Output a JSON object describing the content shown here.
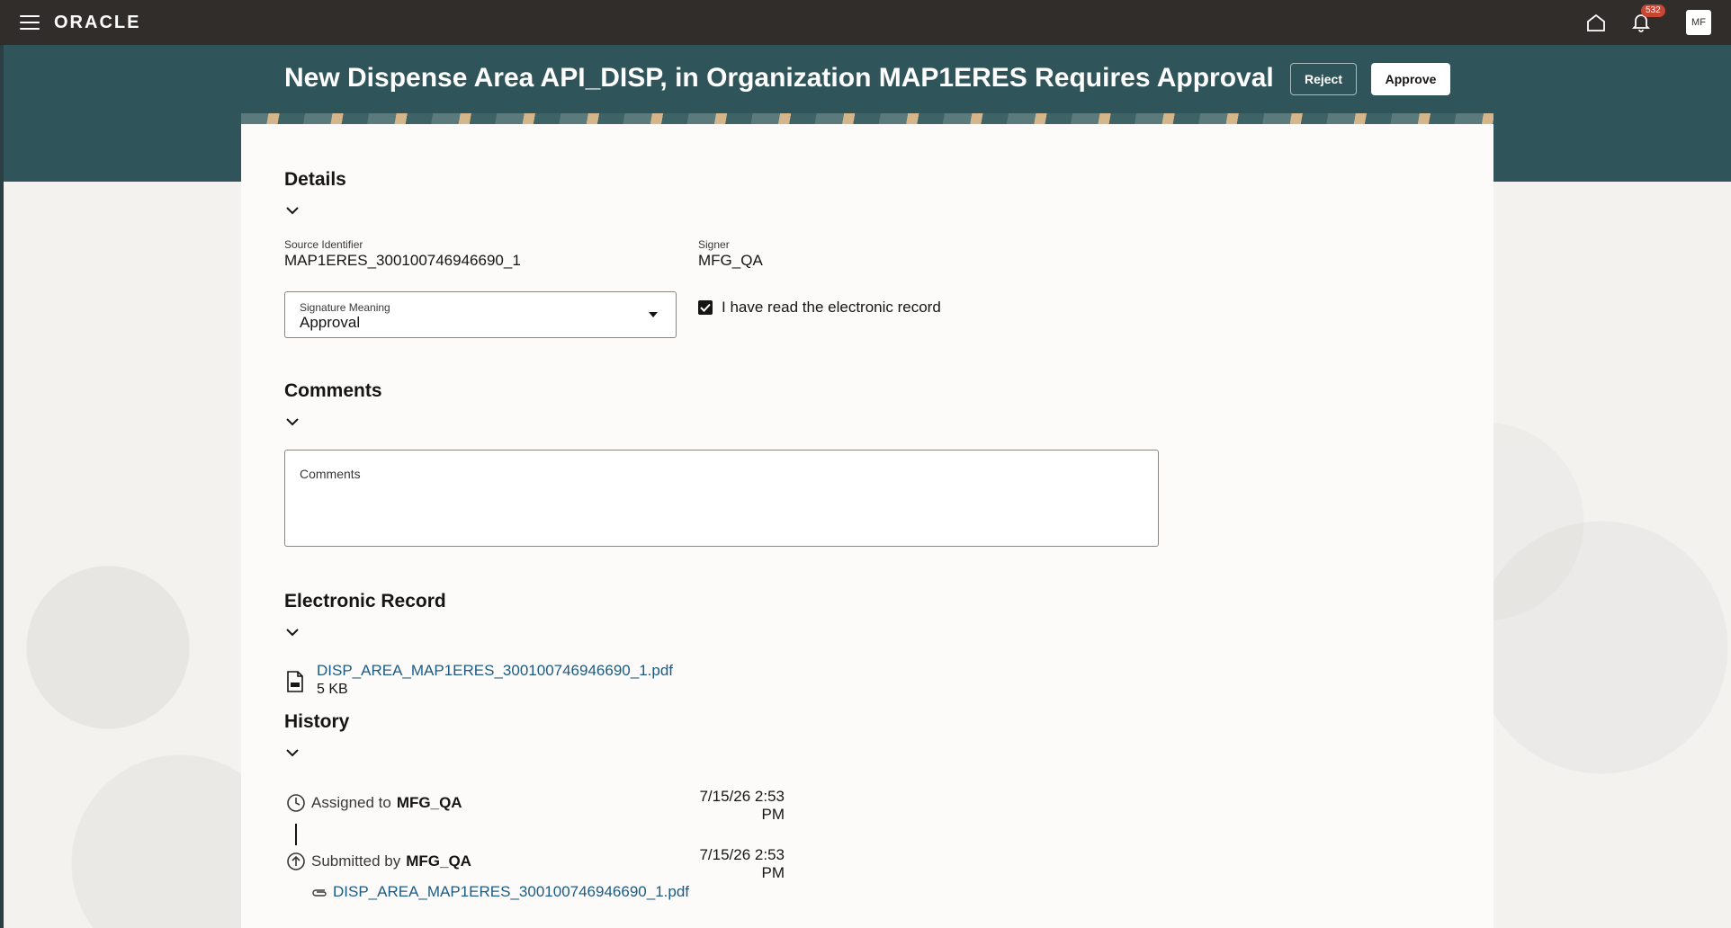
{
  "topbar": {
    "logo": "ORACLE",
    "notification_count": "532",
    "avatar_initials": "MF"
  },
  "header": {
    "title": "New Dispense Area API_DISP, in Organization MAP1ERES Requires Approval",
    "reject_label": "Reject",
    "approve_label": "Approve"
  },
  "details": {
    "title": "Details",
    "source_identifier_label": "Source Identifier",
    "source_identifier_value": "MAP1ERES_300100746946690_1",
    "signer_label": "Signer",
    "signer_value": "MFG_QA",
    "signature_meaning_label": "Signature Meaning",
    "signature_meaning_value": "Approval",
    "read_record_label": "I have read the electronic record",
    "read_record_checked": true
  },
  "comments": {
    "title": "Comments",
    "field_label": "Comments"
  },
  "electronic_record": {
    "title": "Electronic Record",
    "file_name": "DISP_AREA_MAP1ERES_300100746946690_1.pdf",
    "file_size": "5 KB"
  },
  "history": {
    "title": "History",
    "items": [
      {
        "prefix": "Assigned to",
        "user": "MFG_QA",
        "date": "7/15/26 2:53",
        "time": "PM"
      },
      {
        "prefix": "Submitted by",
        "user": "MFG_QA",
        "date": "7/15/26 2:53",
        "time": "PM",
        "attachment": "DISP_AREA_MAP1ERES_300100746946690_1.pdf"
      }
    ]
  }
}
